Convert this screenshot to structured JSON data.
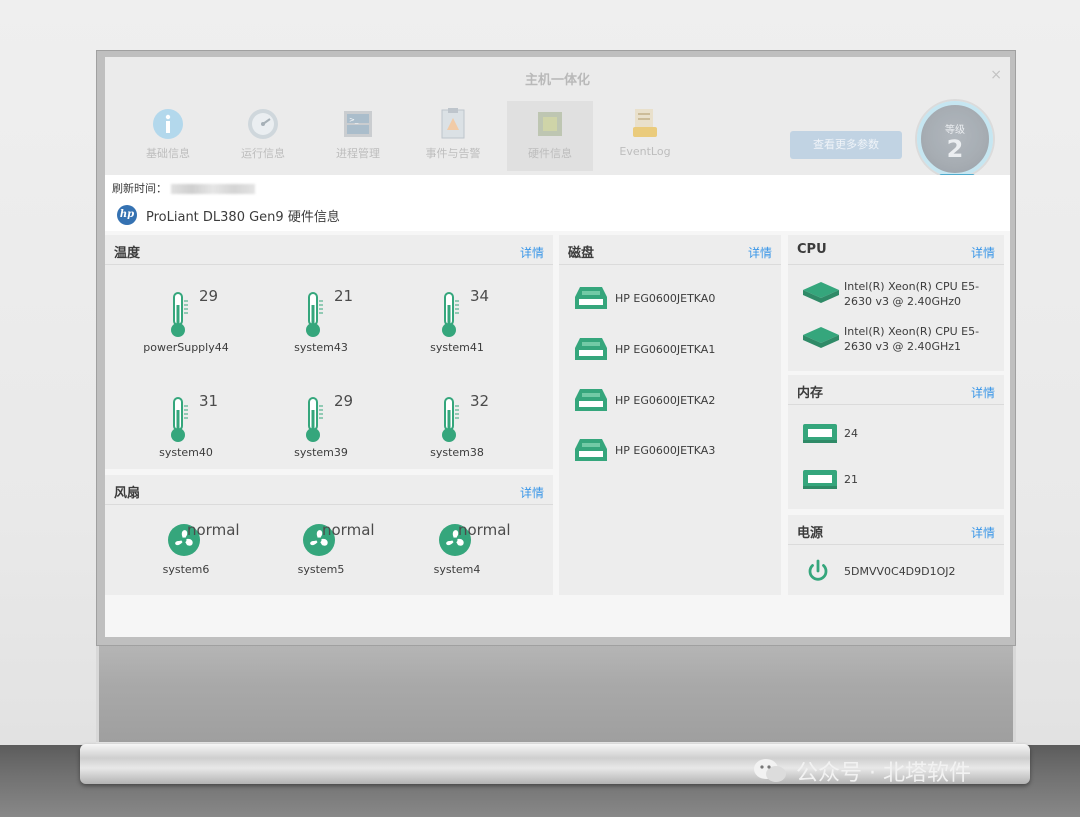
{
  "window": {
    "title": "主机一体化",
    "close": "×"
  },
  "toolbar": {
    "tabs": [
      {
        "label": "基础信息"
      },
      {
        "label": "运行信息"
      },
      {
        "label": "进程管理"
      },
      {
        "label": "事件与告警"
      },
      {
        "label": "硬件信息"
      },
      {
        "label": "EventLog"
      }
    ],
    "more_button": "查看更多参数",
    "level_label": "等级",
    "level_value": "2"
  },
  "info": {
    "refresh_label": "刷新时间：",
    "model": "ProLiant DL380 Gen9 硬件信息",
    "logo_text": "hp"
  },
  "temperature": {
    "title": "温度",
    "detail": "详情",
    "sensors": [
      {
        "name": "powerSupply44",
        "value": "29"
      },
      {
        "name": "system43",
        "value": "21"
      },
      {
        "name": "system41",
        "value": "34"
      },
      {
        "name": "system40",
        "value": "31"
      },
      {
        "name": "system39",
        "value": "29"
      },
      {
        "name": "system38",
        "value": "32"
      }
    ]
  },
  "fans": {
    "title": "风扇",
    "detail": "详情",
    "items": [
      {
        "name": "system6",
        "status": "normal"
      },
      {
        "name": "system5",
        "status": "normal"
      },
      {
        "name": "system4",
        "status": "normal"
      }
    ]
  },
  "disks": {
    "title": "磁盘",
    "detail": "详情",
    "items": [
      {
        "name": "HP EG0600JETKA0"
      },
      {
        "name": "HP EG0600JETKA1"
      },
      {
        "name": "HP EG0600JETKA2"
      },
      {
        "name": "HP EG0600JETKA3"
      }
    ]
  },
  "cpu": {
    "title": "CPU",
    "detail": "详情",
    "items": [
      {
        "name": "Intel(R) Xeon(R) CPU E5-2630 v3 @ 2.40GHz0"
      },
      {
        "name": "Intel(R) Xeon(R) CPU E5-2630 v3 @ 2.40GHz1"
      }
    ]
  },
  "memory": {
    "title": "内存",
    "detail": "详情",
    "items": [
      {
        "value": "24"
      },
      {
        "value": "21"
      }
    ]
  },
  "power": {
    "title": "电源",
    "detail": "详情",
    "serial": "5DMVV0C4D9D1OJ2"
  },
  "watermark": "公众号 · 北塔软件",
  "colors": {
    "accent_green": "#1a9a6a",
    "link_blue": "#1e88e5"
  },
  "icons": {
    "tabs": [
      "info-icon",
      "gauge-icon",
      "terminal-icon",
      "clipboard-alert-icon",
      "chip-icon",
      "eventlog-icon"
    ],
    "temperature": "thermometer-icon",
    "fan": "fan-icon",
    "disk": "disk-drive-icon",
    "cpu": "cpu-chip-icon",
    "memory": "memory-module-icon",
    "power": "power-icon"
  }
}
